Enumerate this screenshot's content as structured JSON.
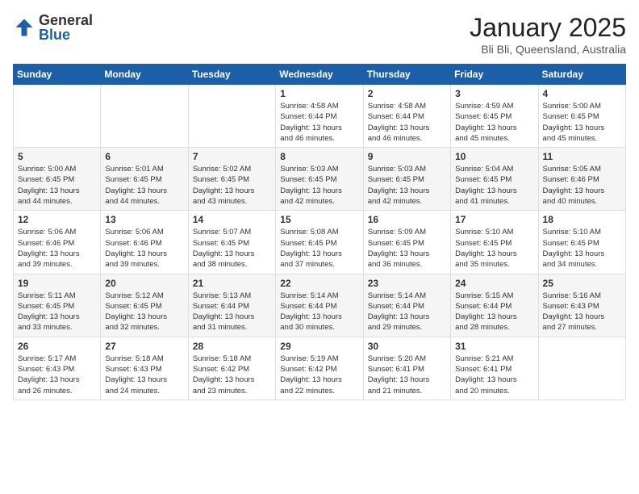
{
  "logo": {
    "general": "General",
    "blue": "Blue"
  },
  "header": {
    "title": "January 2025",
    "subtitle": "Bli Bli, Queensland, Australia"
  },
  "weekdays": [
    "Sunday",
    "Monday",
    "Tuesday",
    "Wednesday",
    "Thursday",
    "Friday",
    "Saturday"
  ],
  "weeks": [
    [
      {
        "day": "",
        "info": ""
      },
      {
        "day": "",
        "info": ""
      },
      {
        "day": "",
        "info": ""
      },
      {
        "day": "1",
        "info": "Sunrise: 4:58 AM\nSunset: 6:44 PM\nDaylight: 13 hours\nand 46 minutes."
      },
      {
        "day": "2",
        "info": "Sunrise: 4:58 AM\nSunset: 6:44 PM\nDaylight: 13 hours\nand 46 minutes."
      },
      {
        "day": "3",
        "info": "Sunrise: 4:59 AM\nSunset: 6:45 PM\nDaylight: 13 hours\nand 45 minutes."
      },
      {
        "day": "4",
        "info": "Sunrise: 5:00 AM\nSunset: 6:45 PM\nDaylight: 13 hours\nand 45 minutes."
      }
    ],
    [
      {
        "day": "5",
        "info": "Sunrise: 5:00 AM\nSunset: 6:45 PM\nDaylight: 13 hours\nand 44 minutes."
      },
      {
        "day": "6",
        "info": "Sunrise: 5:01 AM\nSunset: 6:45 PM\nDaylight: 13 hours\nand 44 minutes."
      },
      {
        "day": "7",
        "info": "Sunrise: 5:02 AM\nSunset: 6:45 PM\nDaylight: 13 hours\nand 43 minutes."
      },
      {
        "day": "8",
        "info": "Sunrise: 5:03 AM\nSunset: 6:45 PM\nDaylight: 13 hours\nand 42 minutes."
      },
      {
        "day": "9",
        "info": "Sunrise: 5:03 AM\nSunset: 6:45 PM\nDaylight: 13 hours\nand 42 minutes."
      },
      {
        "day": "10",
        "info": "Sunrise: 5:04 AM\nSunset: 6:45 PM\nDaylight: 13 hours\nand 41 minutes."
      },
      {
        "day": "11",
        "info": "Sunrise: 5:05 AM\nSunset: 6:46 PM\nDaylight: 13 hours\nand 40 minutes."
      }
    ],
    [
      {
        "day": "12",
        "info": "Sunrise: 5:06 AM\nSunset: 6:46 PM\nDaylight: 13 hours\nand 39 minutes."
      },
      {
        "day": "13",
        "info": "Sunrise: 5:06 AM\nSunset: 6:46 PM\nDaylight: 13 hours\nand 39 minutes."
      },
      {
        "day": "14",
        "info": "Sunrise: 5:07 AM\nSunset: 6:45 PM\nDaylight: 13 hours\nand 38 minutes."
      },
      {
        "day": "15",
        "info": "Sunrise: 5:08 AM\nSunset: 6:45 PM\nDaylight: 13 hours\nand 37 minutes."
      },
      {
        "day": "16",
        "info": "Sunrise: 5:09 AM\nSunset: 6:45 PM\nDaylight: 13 hours\nand 36 minutes."
      },
      {
        "day": "17",
        "info": "Sunrise: 5:10 AM\nSunset: 6:45 PM\nDaylight: 13 hours\nand 35 minutes."
      },
      {
        "day": "18",
        "info": "Sunrise: 5:10 AM\nSunset: 6:45 PM\nDaylight: 13 hours\nand 34 minutes."
      }
    ],
    [
      {
        "day": "19",
        "info": "Sunrise: 5:11 AM\nSunset: 6:45 PM\nDaylight: 13 hours\nand 33 minutes."
      },
      {
        "day": "20",
        "info": "Sunrise: 5:12 AM\nSunset: 6:45 PM\nDaylight: 13 hours\nand 32 minutes."
      },
      {
        "day": "21",
        "info": "Sunrise: 5:13 AM\nSunset: 6:44 PM\nDaylight: 13 hours\nand 31 minutes."
      },
      {
        "day": "22",
        "info": "Sunrise: 5:14 AM\nSunset: 6:44 PM\nDaylight: 13 hours\nand 30 minutes."
      },
      {
        "day": "23",
        "info": "Sunrise: 5:14 AM\nSunset: 6:44 PM\nDaylight: 13 hours\nand 29 minutes."
      },
      {
        "day": "24",
        "info": "Sunrise: 5:15 AM\nSunset: 6:44 PM\nDaylight: 13 hours\nand 28 minutes."
      },
      {
        "day": "25",
        "info": "Sunrise: 5:16 AM\nSunset: 6:43 PM\nDaylight: 13 hours\nand 27 minutes."
      }
    ],
    [
      {
        "day": "26",
        "info": "Sunrise: 5:17 AM\nSunset: 6:43 PM\nDaylight: 13 hours\nand 26 minutes."
      },
      {
        "day": "27",
        "info": "Sunrise: 5:18 AM\nSunset: 6:43 PM\nDaylight: 13 hours\nand 24 minutes."
      },
      {
        "day": "28",
        "info": "Sunrise: 5:18 AM\nSunset: 6:42 PM\nDaylight: 13 hours\nand 23 minutes."
      },
      {
        "day": "29",
        "info": "Sunrise: 5:19 AM\nSunset: 6:42 PM\nDaylight: 13 hours\nand 22 minutes."
      },
      {
        "day": "30",
        "info": "Sunrise: 5:20 AM\nSunset: 6:41 PM\nDaylight: 13 hours\nand 21 minutes."
      },
      {
        "day": "31",
        "info": "Sunrise: 5:21 AM\nSunset: 6:41 PM\nDaylight: 13 hours\nand 20 minutes."
      },
      {
        "day": "",
        "info": ""
      }
    ]
  ]
}
